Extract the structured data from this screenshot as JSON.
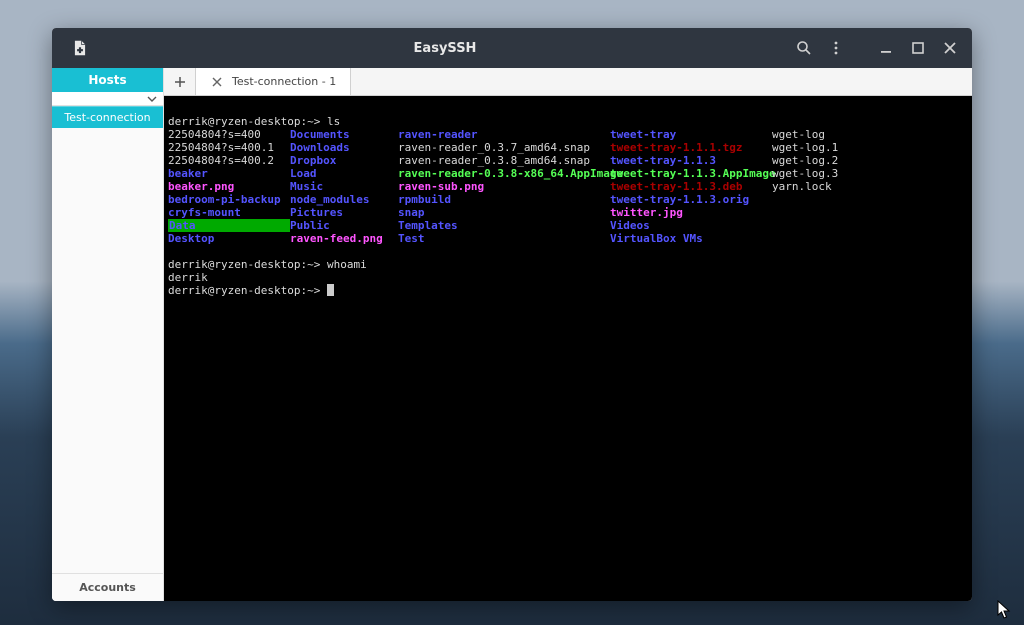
{
  "window": {
    "title": "EasySSH"
  },
  "sidebar": {
    "hosts_label": "Hosts",
    "connection_item": "Test-connection",
    "accounts_label": "Accounts"
  },
  "tabs": {
    "active_label": "Test-connection - 1"
  },
  "terminal": {
    "prompt": "derrik@ryzen-desktop:~>",
    "cmd_ls": "ls",
    "cmd_whoami": "whoami",
    "whoami_out": "derrik",
    "ls_rows": [
      [
        {
          "t": "22504804?s=400",
          "c": "c-white"
        },
        {
          "t": "Documents",
          "c": "c-blue"
        },
        {
          "t": "raven-reader",
          "c": "c-blue"
        },
        {
          "t": "tweet-tray",
          "c": "c-blue"
        },
        {
          "t": "wget-log",
          "c": "c-white"
        }
      ],
      [
        {
          "t": "22504804?s=400.1",
          "c": "c-white"
        },
        {
          "t": "Downloads",
          "c": "c-blue"
        },
        {
          "t": "raven-reader_0.3.7_amd64.snap",
          "c": "c-white"
        },
        {
          "t": "tweet-tray-1.1.1.tgz",
          "c": "c-red"
        },
        {
          "t": "wget-log.1",
          "c": "c-white"
        }
      ],
      [
        {
          "t": "22504804?s=400.2",
          "c": "c-white"
        },
        {
          "t": "Dropbox",
          "c": "c-blue"
        },
        {
          "t": "raven-reader_0.3.8_amd64.snap",
          "c": "c-white"
        },
        {
          "t": "tweet-tray-1.1.3",
          "c": "c-blue"
        },
        {
          "t": "wget-log.2",
          "c": "c-white"
        }
      ],
      [
        {
          "t": "beaker",
          "c": "c-blue"
        },
        {
          "t": "Load",
          "c": "c-blue"
        },
        {
          "t": "raven-reader-0.3.8-x86_64.AppImage",
          "c": "c-green"
        },
        {
          "t": "tweet-tray-1.1.3.AppImage",
          "c": "c-green"
        },
        {
          "t": "wget-log.3",
          "c": "c-white"
        }
      ],
      [
        {
          "t": "beaker.png",
          "c": "c-magenta"
        },
        {
          "t": "Music",
          "c": "c-blue"
        },
        {
          "t": "raven-sub.png",
          "c": "c-magenta"
        },
        {
          "t": "tweet-tray-1.1.3.deb",
          "c": "c-red"
        },
        {
          "t": "yarn.lock",
          "c": "c-white"
        }
      ],
      [
        {
          "t": "bedroom-pi-backup",
          "c": "c-blue"
        },
        {
          "t": "node_modules",
          "c": "c-blue"
        },
        {
          "t": "rpmbuild",
          "c": "c-blue"
        },
        {
          "t": "tweet-tray-1.1.3.orig",
          "c": "c-blue"
        },
        {
          "t": "",
          "c": ""
        }
      ],
      [
        {
          "t": "cryfs-mount",
          "c": "c-blue"
        },
        {
          "t": "Pictures",
          "c": "c-blue"
        },
        {
          "t": "snap",
          "c": "c-blue"
        },
        {
          "t": "twitter.jpg",
          "c": "c-magenta"
        },
        {
          "t": "",
          "c": ""
        }
      ],
      [
        {
          "t": "Data",
          "c": "c-green-bg"
        },
        {
          "t": "Public",
          "c": "c-blue"
        },
        {
          "t": "Templates",
          "c": "c-blue"
        },
        {
          "t": "Videos",
          "c": "c-blue"
        },
        {
          "t": "",
          "c": ""
        }
      ],
      [
        {
          "t": "Desktop",
          "c": "c-blue"
        },
        {
          "t": "raven-feed.png",
          "c": "c-magenta"
        },
        {
          "t": "Test",
          "c": "c-blue"
        },
        {
          "t": "VirtualBox VMs",
          "c": "c-blue"
        },
        {
          "t": "",
          "c": ""
        }
      ]
    ]
  }
}
